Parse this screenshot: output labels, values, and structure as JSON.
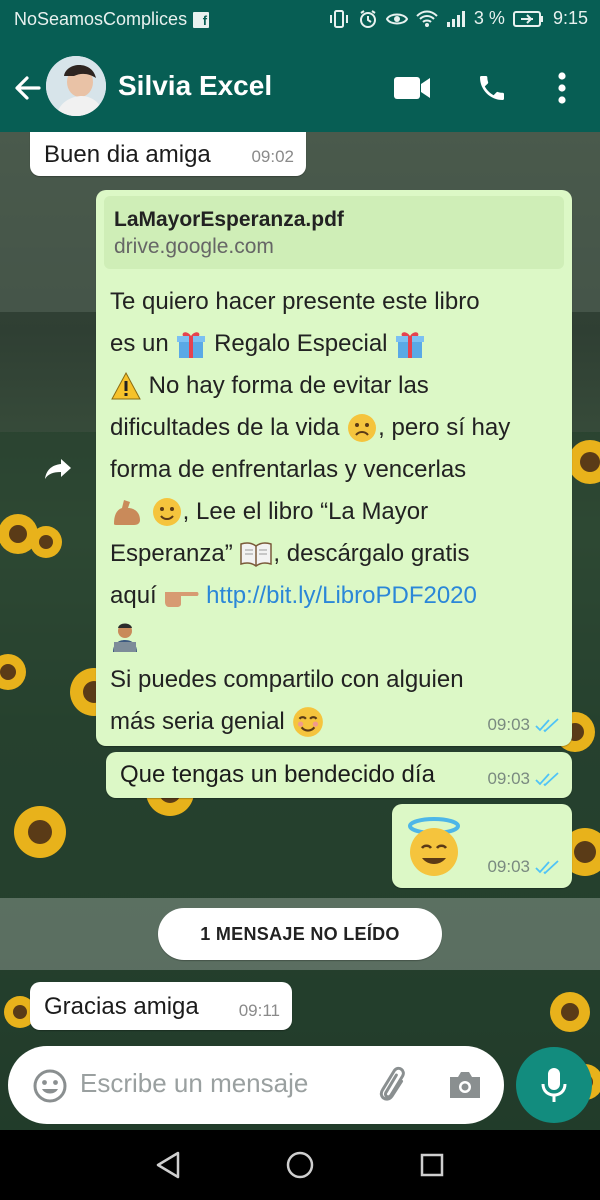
{
  "status_bar": {
    "carrier": "NoSeamosComplices",
    "carrier_badge": "f",
    "battery": "3 %",
    "time": "9:15"
  },
  "header": {
    "contact_name": "Silvia Excel"
  },
  "messages": [
    {
      "direction": "incoming",
      "text": "Buen dia amiga",
      "time": "09:02"
    },
    {
      "direction": "outgoing",
      "link_preview": {
        "title": "LaMayorEsperanza.pdf",
        "domain": "drive.google.com"
      },
      "lines": [
        "Te quiero hacer presente este libro",
        "es un",
        "Regalo Especial",
        "No hay forma de evitar las",
        "dificultades de la vida",
        ", pero sí hay",
        "forma de enfrentarlas y vencerlas",
        ",  Lee el libro “La Mayor",
        "Esperanza”",
        ", descárgalo gratis",
        "aquí",
        "Si puedes compartilo con alguien",
        "más seria genial"
      ],
      "link": "http://bit.ly/LibroPDF2020",
      "time": "09:03",
      "status": "read"
    },
    {
      "direction": "outgoing",
      "text": "Que tengas un bendecido día",
      "time": "09:03",
      "status": "read"
    },
    {
      "direction": "outgoing",
      "emoji": "smiling-face-with-halo",
      "time": "09:03",
      "status": "read"
    },
    {
      "direction": "incoming",
      "text": "Gracias amiga",
      "time": "09:11"
    }
  ],
  "unread_banner": "1 MENSAJE NO LEÍDO",
  "composer": {
    "placeholder": "Escribe un mensaje"
  },
  "colors": {
    "header": "#075e54",
    "outgoing_bubble": "#dcf8c6",
    "incoming_bubble": "#ffffff",
    "link": "#2b87d8",
    "read_ticks": "#4fc3f7",
    "fab": "#128c7e"
  },
  "icons": [
    "back-arrow-icon",
    "video-call-icon",
    "phone-icon",
    "more-vert-icon",
    "forward-icon",
    "emoji-icon",
    "attach-icon",
    "camera-icon",
    "mic-icon",
    "nav-back-icon",
    "nav-home-icon",
    "nav-recents-icon"
  ]
}
